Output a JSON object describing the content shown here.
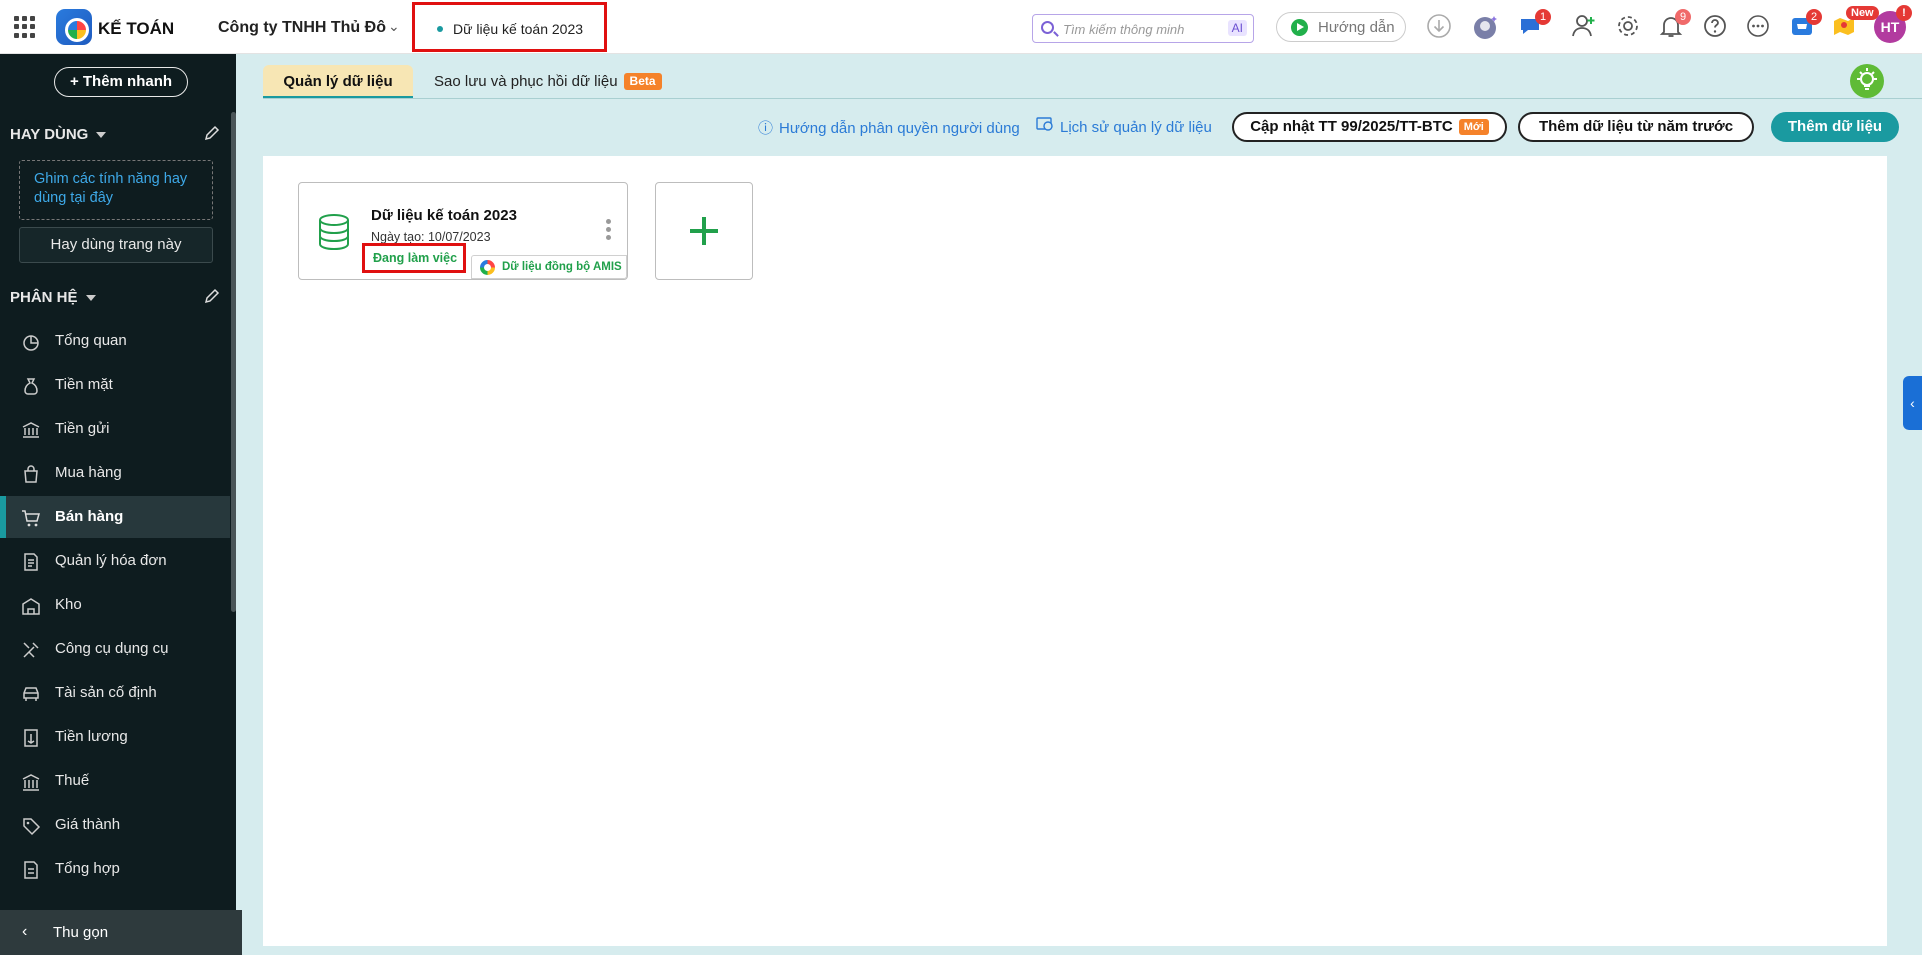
{
  "header": {
    "brand": "KẾ TOÁN",
    "company": "Công ty TNHH Thủ Đô",
    "current_db": "Dữ liệu kế toán 2023",
    "search_placeholder": "Tìm kiếm thông minh",
    "ai_badge": "AI",
    "guide_label": "Hướng dẫn",
    "chat_badge": "1",
    "notifications_badge": "9",
    "cart_badge": "2",
    "new_badge": "New",
    "avatar_initials": "HT",
    "avatar_badge": "!"
  },
  "sidebar": {
    "quick_add": "Thêm nhanh",
    "favorites_title": "HAY DÙNG",
    "pin_hint": "Ghim các tính năng hay dùng tại đây",
    "frequent_button": "Hay dùng trang này",
    "modules_title": "PHÂN HỆ",
    "items": [
      {
        "label": "Tổng quan",
        "icon": "pie-chart-icon"
      },
      {
        "label": "Tiền mặt",
        "icon": "money-bag-icon"
      },
      {
        "label": "Tiền gửi",
        "icon": "bank-icon"
      },
      {
        "label": "Mua hàng",
        "icon": "shopping-bag-icon"
      },
      {
        "label": "Bán hàng",
        "icon": "cart-icon",
        "active": true
      },
      {
        "label": "Quản lý hóa đơn",
        "icon": "invoice-icon"
      },
      {
        "label": "Kho",
        "icon": "warehouse-icon"
      },
      {
        "label": "Công cụ dụng cụ",
        "icon": "tools-icon"
      },
      {
        "label": "Tài sản cố định",
        "icon": "car-icon"
      },
      {
        "label": "Tiền lương",
        "icon": "payroll-icon"
      },
      {
        "label": "Thuế",
        "icon": "tax-building-icon"
      },
      {
        "label": "Giá thành",
        "icon": "price-tag-icon"
      },
      {
        "label": "Tổng hợp",
        "icon": "summary-doc-icon"
      }
    ],
    "collapse_label": "Thu gọn"
  },
  "tabs": [
    {
      "label": "Quản lý dữ liệu",
      "active": true
    },
    {
      "label": "Sao lưu và phục hồi dữ liệu",
      "badge": "Beta"
    }
  ],
  "actions": {
    "permission_guide": "Hướng dẫn phân quyền người dùng",
    "history": "Lịch sử quản lý dữ liệu",
    "update_tt": "Cập nhật TT 99/2025/TT-BTC",
    "update_badge": "Mới",
    "add_from_prev": "Thêm dữ liệu từ năm trước",
    "add_data": "Thêm dữ liệu"
  },
  "data_card": {
    "title": "Dữ liệu kế toán 2023",
    "created": "Ngày tạo: 10/07/2023",
    "status": "Đang làm việc",
    "sync_tag": "Dữ liệu đồng bộ AMIS"
  },
  "colors": {
    "accent": "#1a9aa0",
    "sidebar_bg": "#0e1c1f",
    "status_green": "#21a04b",
    "highlight_red": "#e01010",
    "badge_orange": "#f5822a"
  }
}
